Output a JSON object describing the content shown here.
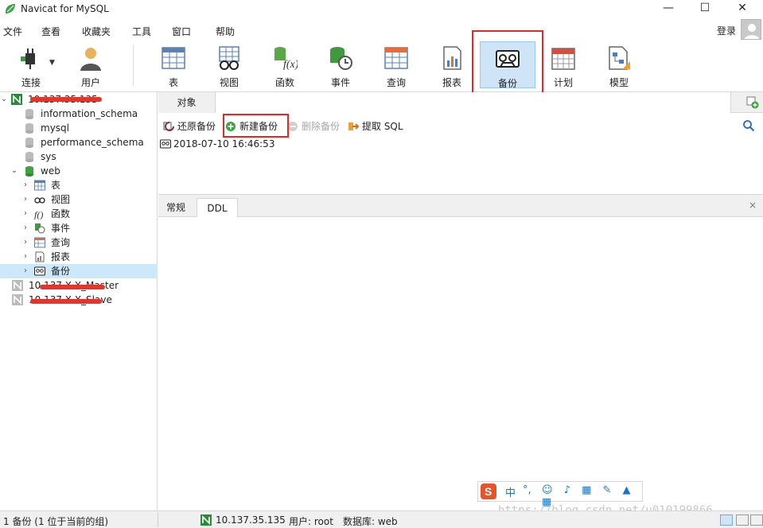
{
  "window": {
    "title": "Navicat for MySQL",
    "minimize": "—",
    "maximize": "☐",
    "close": "✕"
  },
  "menu": [
    "文件",
    "查看",
    "收藏夹",
    "工具",
    "窗口",
    "帮助"
  ],
  "login": "登录",
  "toolbar": {
    "connect": "连接",
    "user": "用户",
    "table": "表",
    "view": "视图",
    "function": "函数",
    "event": "事件",
    "query": "查询",
    "report": "报表",
    "backup": "备份",
    "schedule": "计划",
    "model": "模型"
  },
  "tree": {
    "conn1": "10.137.35.135",
    "dbs": [
      "information_schema",
      "mysql",
      "performance_schema",
      "sys",
      "web"
    ],
    "web_children": [
      "表",
      "视图",
      "函数",
      "事件",
      "查询",
      "报表",
      "备份"
    ],
    "conn2": "10.137.X.X_Master",
    "conn3": "10.137.X.X_Slave"
  },
  "tab_object": "对象",
  "subtoolbar": {
    "restore": "还原备份",
    "new": "新建备份",
    "delete": "删除备份",
    "extract": "提取 SQL"
  },
  "backup_item": "2018-07-10 16:46:53",
  "panel_tabs": {
    "general": "常规",
    "ddl": "DDL",
    "close": "×"
  },
  "ime": {
    "zh": "中",
    "punct": "°,",
    "items": "☺ ♪ ▦ ✎ ▲ ▦"
  },
  "watermark": "https://blog.csdn.net/u010199866",
  "status": {
    "left": "1 备份 (1 位于当前的组)",
    "conn": "10.137.35.135",
    "user": "用户: root",
    "db": "数据库: web"
  },
  "colors": {
    "accent_red": "#e02a2a",
    "select_blue": "#cde8fb",
    "navicat_green": "#2a8a3a"
  }
}
